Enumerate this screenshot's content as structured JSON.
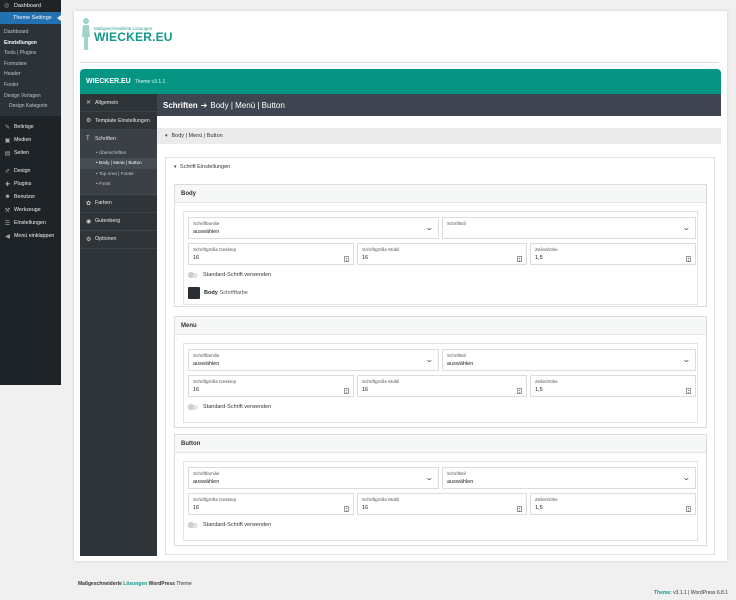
{
  "wp_menu": {
    "dashboard": "Dashboard",
    "theme_settings": "Theme Settings",
    "sub": [
      "Dashboard",
      "Einstellungen",
      "Tools | Plugins",
      "Formulare",
      "Header",
      "Footer",
      "Design Vorlagen",
      "Design Kategorie"
    ],
    "items": [
      "Beiträge",
      "Medien",
      "Seiten",
      "Design",
      "Plugins",
      "Benutzer",
      "Werkzeuge",
      "Einstellungen",
      "Menü einklappen"
    ]
  },
  "logo": {
    "tagline": "Maßgeschneiderte Lösungen",
    "name": "WIECKER.EU"
  },
  "header": {
    "title": "WIECKER.EU",
    "version": "Theme v3.1.1"
  },
  "side_nav": {
    "allgemein": "Allgemein",
    "template": "Template Einstellungen",
    "schriften": "Schriften",
    "schriften_sub": [
      "Überschriften",
      "Body | Menü | Button",
      "Top Area | Footer",
      "Fonts"
    ],
    "farben": "Farben",
    "gutenberg": "Gutenberg",
    "optionen": "Optionen"
  },
  "page_header": {
    "main": "Schriften",
    "arrow": "➔",
    "sub": "Body | Menü | Button"
  },
  "breadcrumb": "Body | Menü | Button",
  "outer_title": "Schrift Einstellungen",
  "labels": {
    "family": "Schriftfamilie",
    "style": "Schriftstil",
    "desktop": "Schriftgröße Desktop",
    "mobile": "Schriftgröße Mobil",
    "lineheight": "Zeilenhöhe",
    "standard": "Standard-Schrift verwenden"
  },
  "sections": [
    {
      "title": "Body",
      "family": "auswählen",
      "style": "",
      "desktop": "16",
      "mobile": "16",
      "lineheight": "1,5",
      "color_bold": "Body",
      "color_label": "Schriftfarbe"
    },
    {
      "title": "Menu",
      "family": "auswählen",
      "style": "auswählen",
      "desktop": "16",
      "mobile": "16",
      "lineheight": "1,5"
    },
    {
      "title": "Button",
      "family": "auswählen",
      "style": "auswählen",
      "desktop": "16",
      "mobile": "16",
      "lineheight": "1,5"
    }
  ],
  "footer": {
    "left_a": "Maßgeschneiderte",
    "left_b": "Lösungen",
    "left_c": "WordPress",
    "left_d": "Theme",
    "right_a": "Theme:",
    "right_b": "v3.1.1  |  WordPress 6.8.1"
  },
  "colors": {
    "accent": "#069483",
    "admin_bar": "#1d2327",
    "active": "#2271b1"
  }
}
